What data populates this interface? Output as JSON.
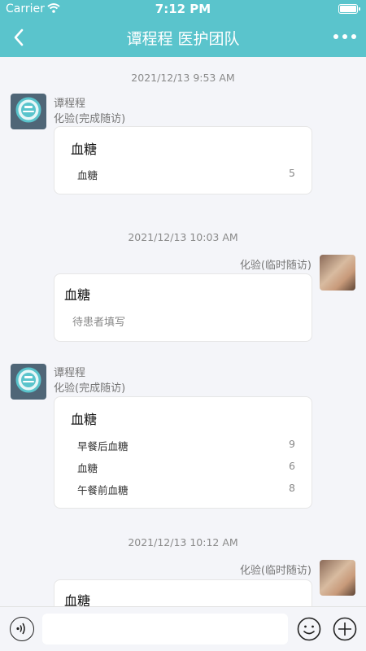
{
  "status_bar": {
    "carrier": "Carrier",
    "time": "7:12 PM"
  },
  "nav": {
    "title": "谭程程 医护团队"
  },
  "messages": [
    {
      "timestamp": "2021/12/13 9:53 AM",
      "sender": "谭程程",
      "subtitle": "化验(完成随访)",
      "card_title": "血糖",
      "rows": [
        {
          "label": "血糖",
          "value": "5"
        }
      ]
    },
    {
      "timestamp": "2021/12/13 10:03 AM",
      "subtitle": "化验(临时随访)",
      "card_title": "血糖",
      "note": "待患者填写"
    },
    {
      "sender": "谭程程",
      "subtitle": "化验(完成随访)",
      "card_title": "血糖",
      "rows": [
        {
          "label": "早餐后血糖",
          "value": "9"
        },
        {
          "label": "血糖",
          "value": "6"
        },
        {
          "label": "午餐前血糖",
          "value": "8"
        }
      ]
    },
    {
      "timestamp": "2021/12/13 10:12 AM",
      "subtitle": "化验(临时随访)",
      "card_title": "血糖"
    }
  ],
  "input": {
    "value": ""
  },
  "icons": {
    "back": "chevron-left-icon",
    "more": "more-dots-icon",
    "voice": "voice-icon",
    "emoji": "emoji-icon",
    "plus": "plus-icon"
  },
  "colors": {
    "accent": "#5ac4cc",
    "background": "#f4f5f9"
  }
}
